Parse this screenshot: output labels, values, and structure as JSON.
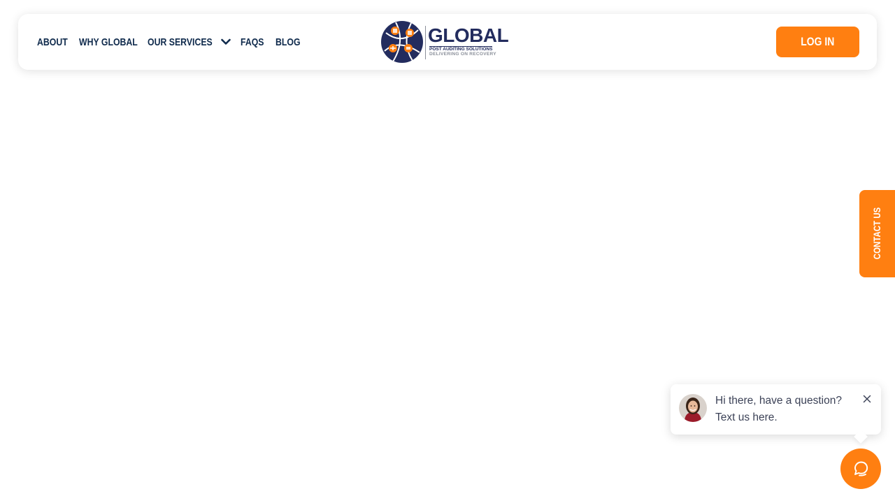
{
  "nav": {
    "links": [
      {
        "label": "ABOUT"
      },
      {
        "label": "WHY GLOBAL"
      },
      {
        "label": "OUR SERVICES"
      },
      {
        "label": "FAQS"
      },
      {
        "label": "BLOG"
      }
    ],
    "login_label": "LOG IN"
  },
  "logo": {
    "name": "GLOBAL",
    "tagline": "POST AUDITING SOLUTIONS",
    "slogan": "DELIVERING ON RECOVERY"
  },
  "contact_tab": {
    "label": "CONTACT US"
  },
  "chat": {
    "message_line1": "Hi there, have a question?",
    "message_line2": "Text us here."
  },
  "colors": {
    "brand_orange": "#ff7f11",
    "brand_navy": "#232c5e",
    "nav_text": "#0f2a4c"
  },
  "icons": {
    "dropdown": "chevron-down-icon",
    "chat_close": "close-icon",
    "chat_launcher": "chat-bubble-icon"
  }
}
